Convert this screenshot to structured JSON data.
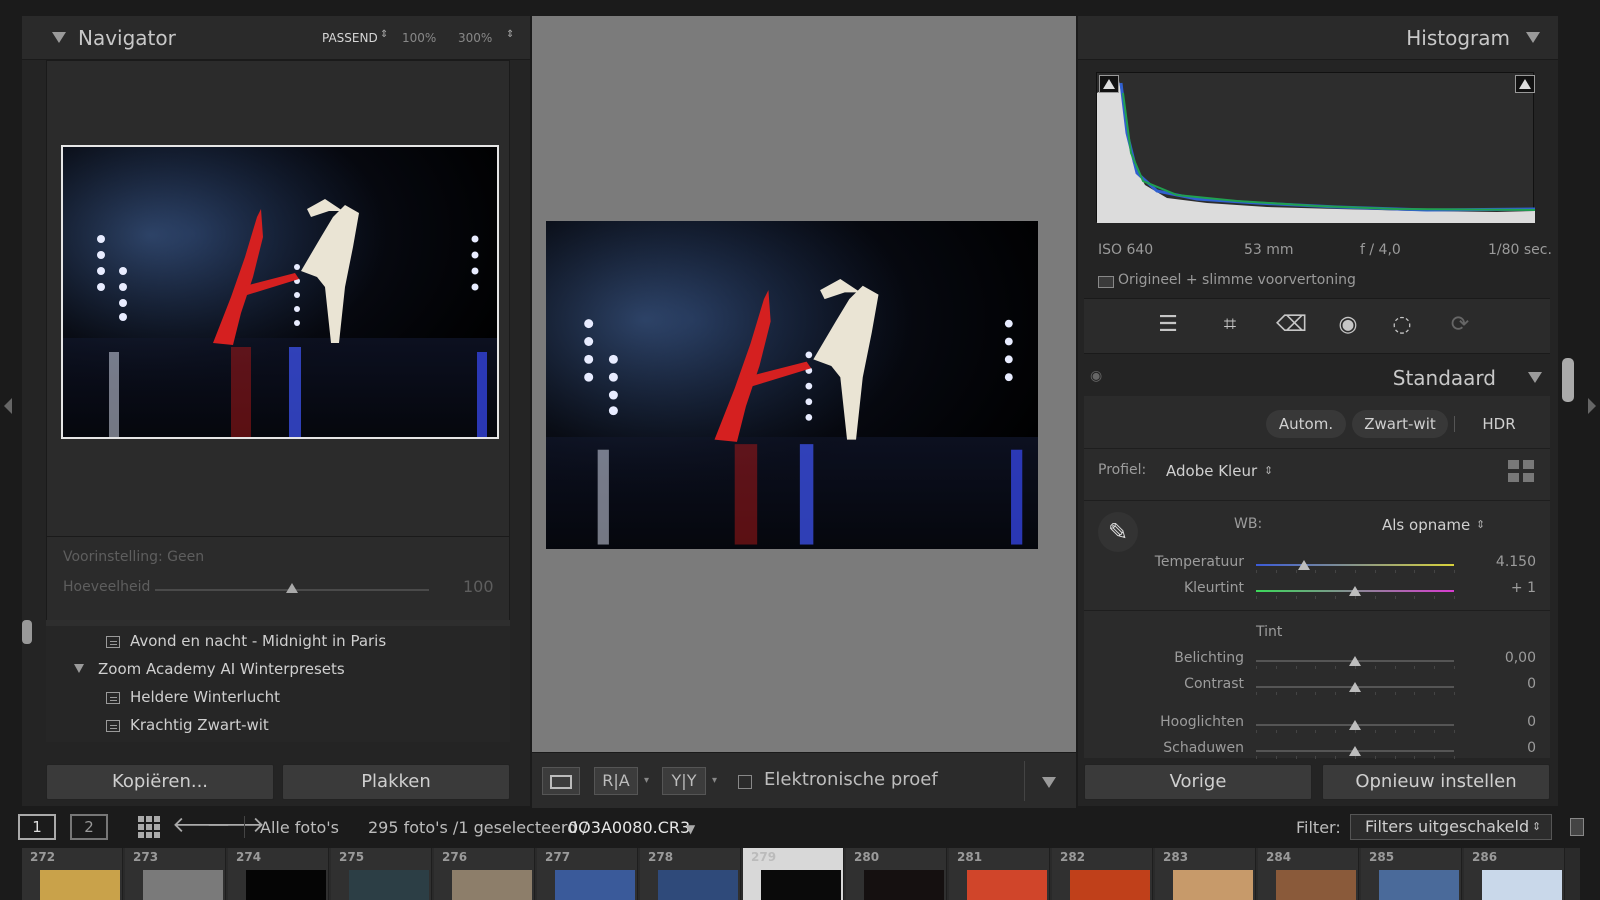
{
  "navigator": {
    "title": "Navigator",
    "zoom_fit": "PASSEND",
    "zoom_100": "100%",
    "zoom_300": "300%"
  },
  "preset": {
    "label": "Voorinstelling: Geen",
    "amount_label": "Hoeveelheid",
    "amount_value": "100",
    "amount_fraction": 0.5
  },
  "preset_list": {
    "items": [
      {
        "label": "Avond en nacht - Midnight in Paris",
        "type": "preset"
      },
      {
        "label": "Zoom Academy AI Winterpresets",
        "type": "folder"
      },
      {
        "label": "Heldere Winterlucht",
        "type": "preset"
      },
      {
        "label": "Krachtig Zwart-wit",
        "type": "preset"
      }
    ]
  },
  "left_buttons": {
    "copy": "Kopiëren...",
    "paste": "Plakken"
  },
  "toolbar": {
    "ra": "R|A",
    "yy": "Y|Y",
    "softproof_label": "Elektronische proef"
  },
  "histogram": {
    "title": "Histogram",
    "iso": "ISO 640",
    "focal": "53 mm",
    "aperture": "f / 4,0",
    "shutter": "1/80 sec.",
    "preview_label": "Origineel + slimme voorvertoning"
  },
  "basic": {
    "title": "Standaard",
    "auto": "Autom.",
    "bw": "Zwart-wit",
    "hdr": "HDR",
    "profile_label": "Profiel:",
    "profile_value": "Adobe Kleur",
    "wb_label": "WB:",
    "wb_value": "Als opname",
    "tint_section": "Tint",
    "sliders": [
      {
        "label": "Temperatuur",
        "value": "4.150",
        "fraction": 0.24
      },
      {
        "label": "Kleurtint",
        "value": "+ 1",
        "fraction": 0.5
      },
      {
        "label": "Belichting",
        "value": "0,00",
        "fraction": 0.5
      },
      {
        "label": "Contrast",
        "value": "0",
        "fraction": 0.5
      },
      {
        "label": "Hooglichten",
        "value": "0",
        "fraction": 0.5
      },
      {
        "label": "Schaduwen",
        "value": "0",
        "fraction": 0.5
      }
    ]
  },
  "right_buttons": {
    "previous": "Vorige",
    "reset": "Opnieuw instellen"
  },
  "filmstrip_header": {
    "view1": "1",
    "view2": "2",
    "source": "Alle foto's",
    "count_text": "295 foto's /1 geselecteerd /",
    "filename": "0O3A0080.CR3",
    "filter_label": "Filter:",
    "filter_value": "Filters uitgeschakeld"
  },
  "filmstrip": {
    "cells": [
      "272",
      "273",
      "274",
      "275",
      "276",
      "277",
      "278",
      "279",
      "280",
      "281",
      "282",
      "283",
      "284",
      "285",
      "286"
    ],
    "selected": "279",
    "colors": [
      "#c9a24a",
      "#7a7a7a",
      "#050505",
      "#2c3e45",
      "#8d7e6a",
      "#3a5a9a",
      "#2f4a7a",
      "#0a0a0a",
      "#151010",
      "#d0452a",
      "#c0401a",
      "#c79a6a",
      "#8a5a3a",
      "#4a6a9a",
      "#c9d8ea"
    ]
  },
  "colors": {
    "panel": "#242424",
    "center_bg": "#7b7b7b"
  }
}
